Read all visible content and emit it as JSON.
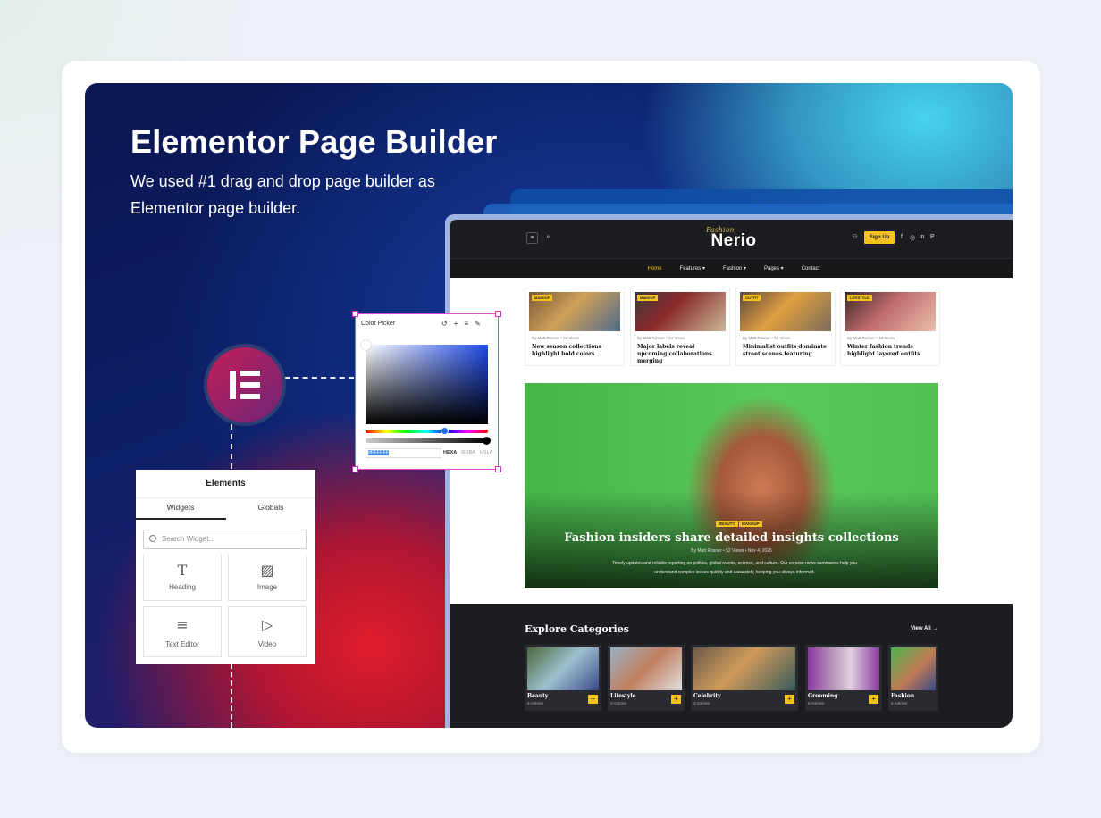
{
  "hero": {
    "title": "Elementor Page Builder",
    "subtitle": "We used #1 drag and drop page builder as Elementor page builder."
  },
  "site": {
    "logo_tagline": "Fashion",
    "logo": "Nerio",
    "signup": "Sign Up",
    "social": [
      "f",
      "◎",
      "in",
      "P"
    ],
    "nav": [
      {
        "label": "Home",
        "active": true
      },
      {
        "label": "Features ▾",
        "active": false
      },
      {
        "label": "Fashion ▾",
        "active": false
      },
      {
        "label": "Pages ▾",
        "active": false
      },
      {
        "label": "Contact",
        "active": false
      }
    ],
    "posts": [
      {
        "tag": "MAKEUP",
        "meta": "By Matt Rosner  •  52 Views",
        "title": "New season collections highlight bold colors"
      },
      {
        "tag": "MAKEUP",
        "meta": "By Matt Rosner  •  64 Views",
        "title": "Major labels reveal upcoming collaborations merging"
      },
      {
        "tag": "OUTFIT",
        "meta": "By Matt Rosner  •  52 Views",
        "title": "Minimalist outfits dominate street scenes featuring"
      },
      {
        "tag": "LIFESTYLE",
        "meta": "By Matt Rosner  •  12 Views",
        "title": "Winter fashion trends highlight layered outfits"
      }
    ],
    "featured": {
      "badges": [
        "BEAUTY",
        "MAKEUP"
      ],
      "title": "Fashion insiders share detailed insights collections",
      "meta": "By Matt Rosner  •  52 Views  •  Nov 4, 2025",
      "description": "Timely updates and reliable reporting on politics, global events, science, and culture. Our concise news summaries help you understand complex issues quickly and accurately, keeping you always informed."
    },
    "categories": {
      "title": "Explore Categories",
      "view_all": "View All →",
      "items": [
        {
          "name": "Beauty",
          "count": "8 Articles"
        },
        {
          "name": "Lifestyle",
          "count": "3 Articles"
        },
        {
          "name": "Celebrity",
          "count": "3 Articles"
        },
        {
          "name": "Grooming",
          "count": "8 Articles"
        },
        {
          "name": "Fashion",
          "count": "6 Articles"
        }
      ]
    }
  },
  "color_picker": {
    "title": "Color Picker",
    "tools": [
      "↺",
      "+",
      "≡",
      "✎"
    ],
    "hex_value": "#FFFFFF",
    "modes": [
      "HEXA",
      "RGBA",
      "HSLA"
    ],
    "active_mode": "HEXA"
  },
  "elements_panel": {
    "title": "Elements",
    "tabs": [
      "Widgets",
      "Globals"
    ],
    "active_tab": "Widgets",
    "search_placeholder": "Search Widget...",
    "widgets": [
      {
        "icon": "T",
        "label": "Heading"
      },
      {
        "icon": "▨",
        "label": "Image"
      },
      {
        "icon": "≡",
        "label": "Text Editor"
      },
      {
        "icon": "▷",
        "label": "Video"
      }
    ]
  },
  "colors": {
    "accent_yellow": "#f4c21c",
    "site_dark": "#1c1d21",
    "elementor_pink": "#c41e55"
  }
}
